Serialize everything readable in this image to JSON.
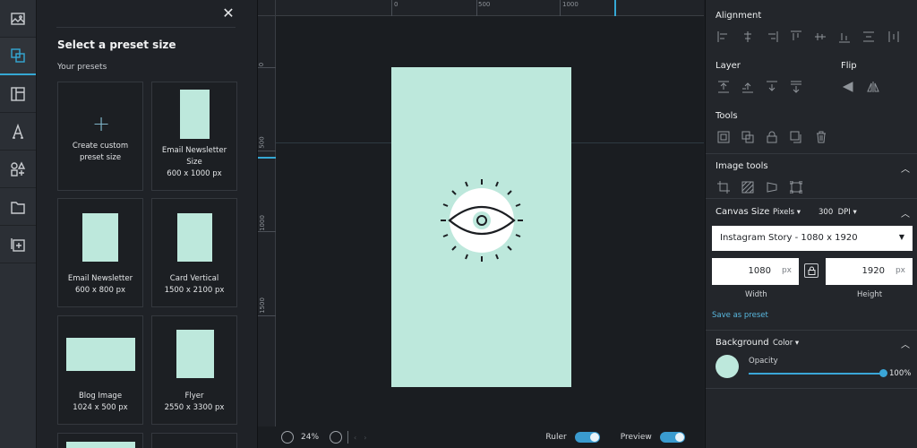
{
  "presets": {
    "title": "Select a preset size",
    "section": "Your presets",
    "items": [
      {
        "name": "Create custom preset size",
        "dims": ""
      },
      {
        "name": "Email Newsletter Size",
        "dims": "600 x 1000 px"
      },
      {
        "name": "Email Newsletter",
        "dims": "600 x 800 px"
      },
      {
        "name": "Card Vertical",
        "dims": "1500 x 2100 px"
      },
      {
        "name": "Blog Image",
        "dims": "1024 x 500 px"
      },
      {
        "name": "Flyer",
        "dims": "2550 x 3300 px"
      }
    ]
  },
  "rulers": {
    "top": [
      "0",
      "500",
      "1000"
    ],
    "left": [
      "0",
      "500",
      "1000",
      "1500"
    ]
  },
  "bottom": {
    "zoom": "24%",
    "ruler_label": "Ruler",
    "preview_label": "Preview"
  },
  "right": {
    "alignment": "Alignment",
    "layer": "Layer",
    "flip": "Flip",
    "tools": "Tools",
    "image_tools": "Image tools",
    "canvas_size": "Canvas Size",
    "unit": "Pixels",
    "dpi_value": "300",
    "dpi_label": "DPI",
    "preset_select": "Instagram Story - 1080 x 1920",
    "width_value": "1080",
    "height_value": "1920",
    "px": "px",
    "width_label": "Width",
    "height_label": "Height",
    "save_preset": "Save as preset",
    "background": "Background",
    "bg_type": "Color",
    "opacity_label": "Opacity",
    "opacity_value": "100%"
  },
  "colors": {
    "accent": "#35a8d4",
    "canvas": "#bde8dc"
  }
}
